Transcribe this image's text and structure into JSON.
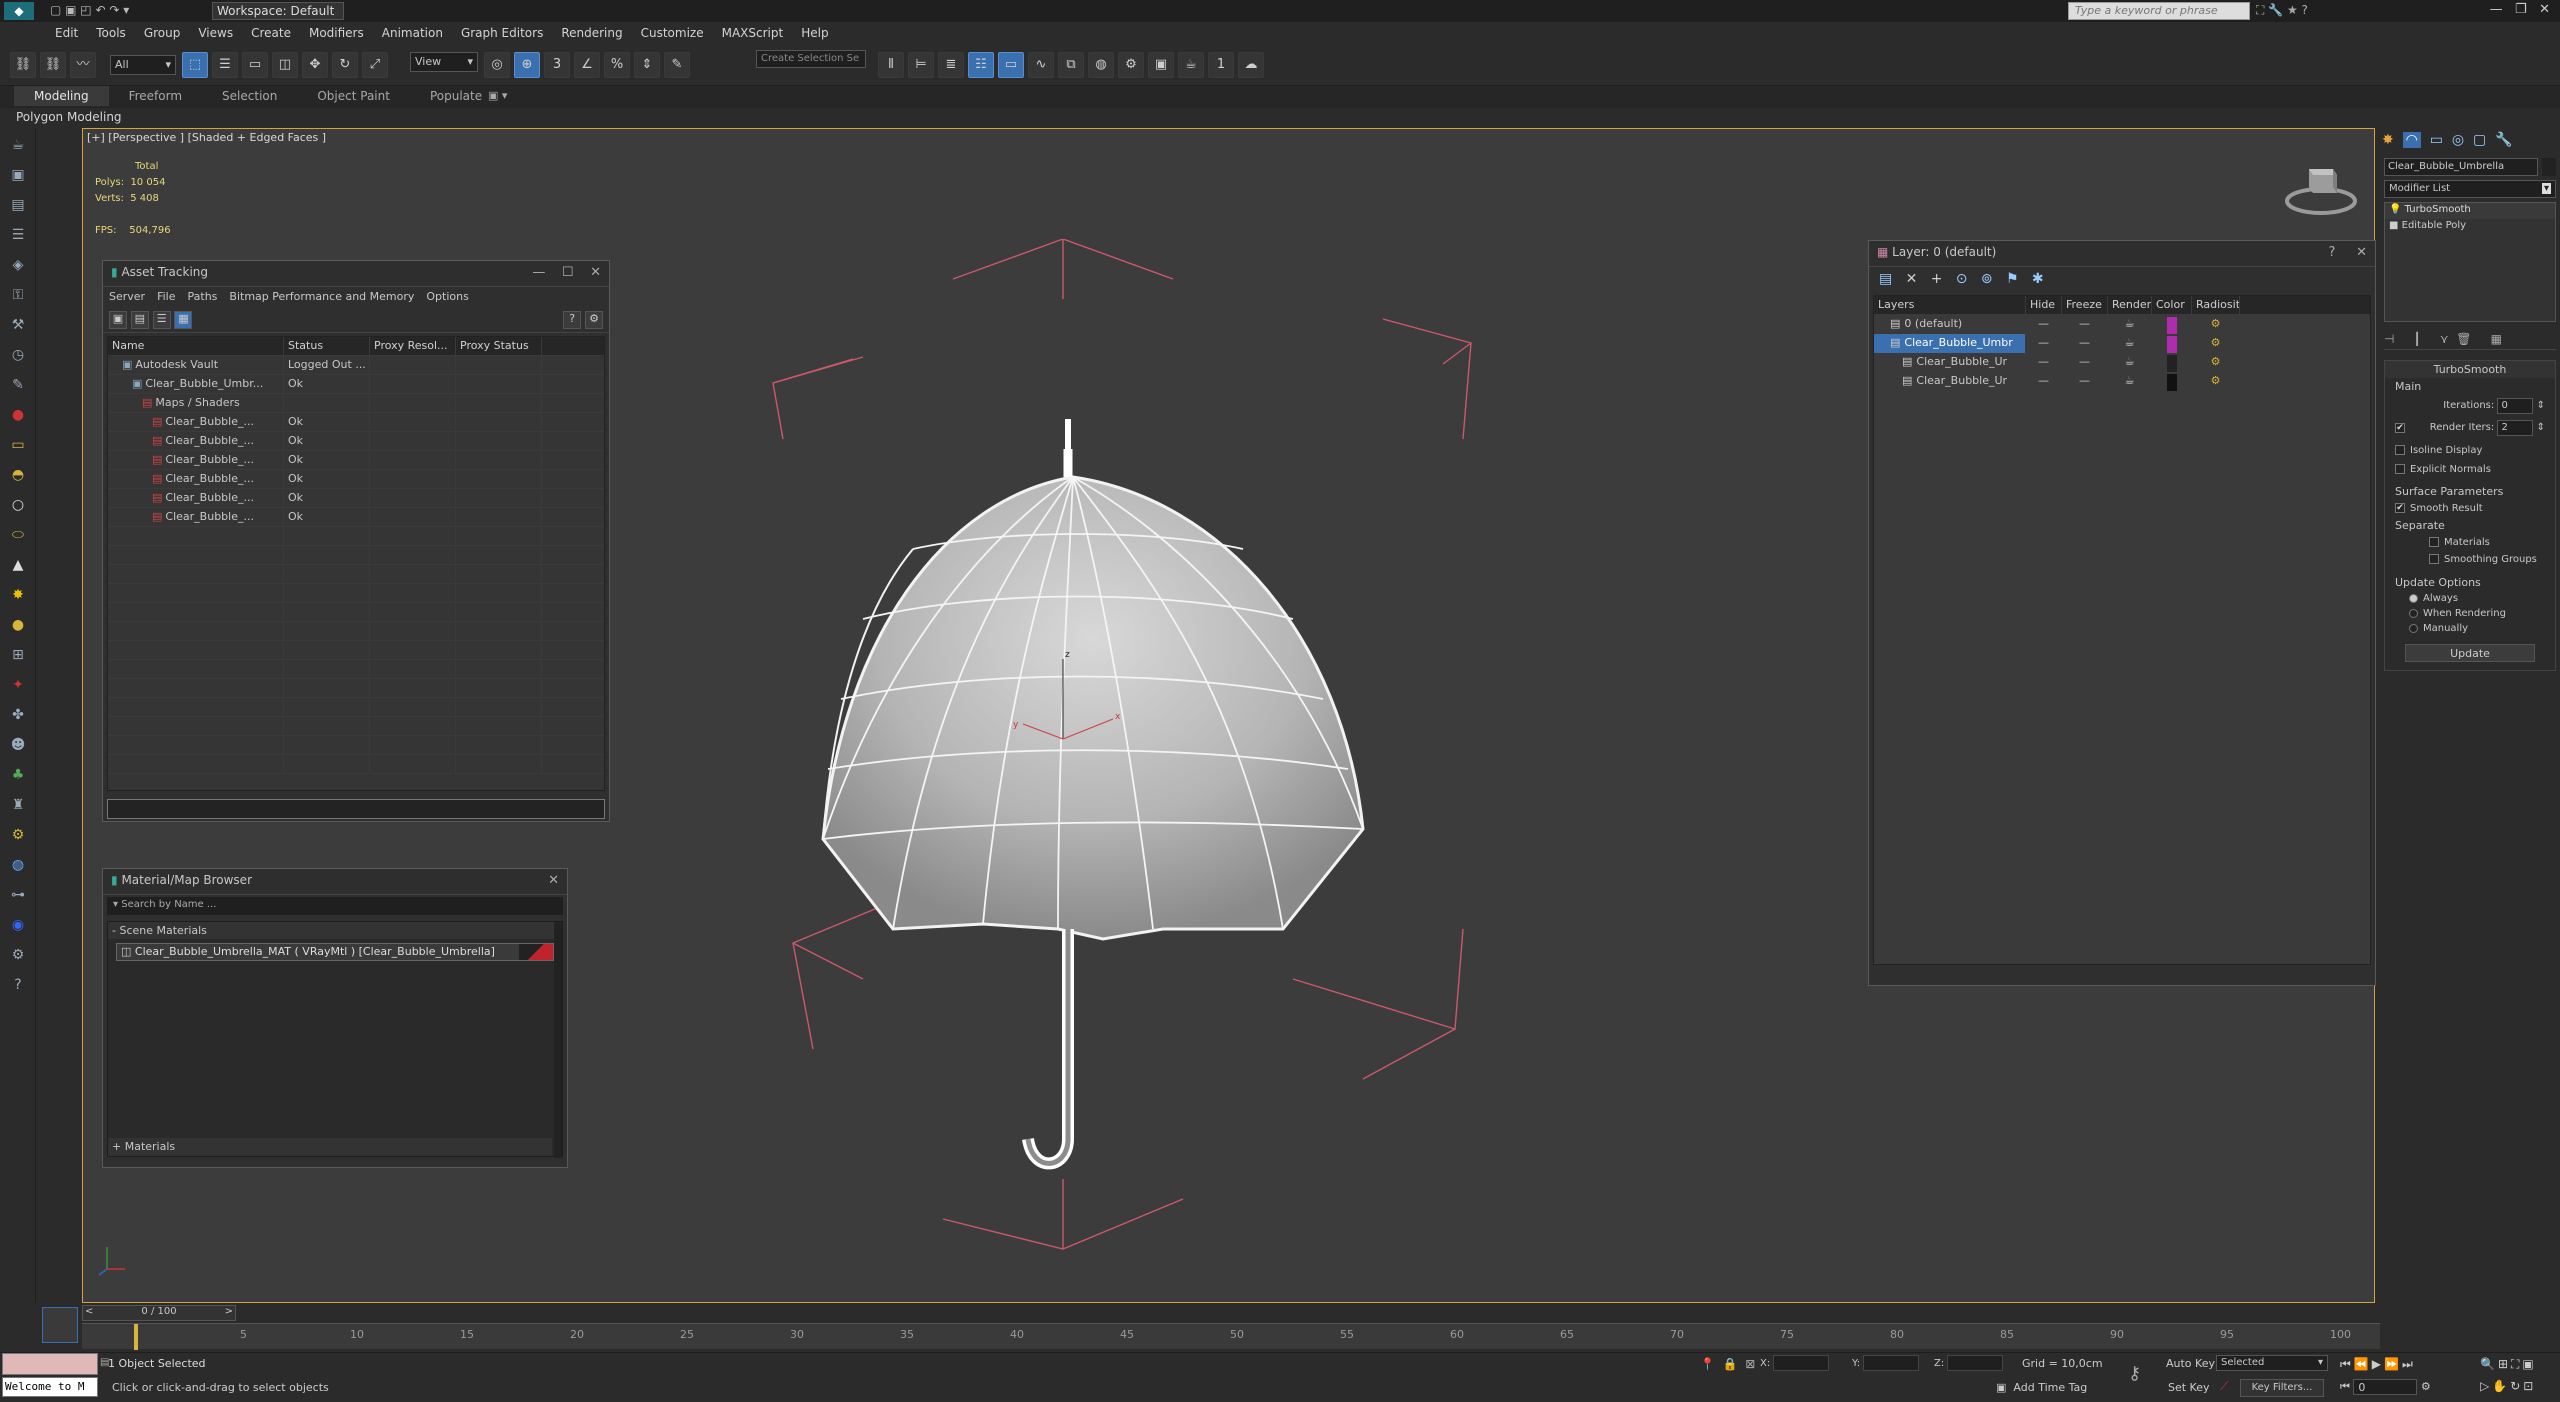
{
  "titlebar": {
    "workspace_label": "Workspace: Default",
    "search_placeholder": "Type a keyword or phrase"
  },
  "menu": [
    "Edit",
    "Tools",
    "Group",
    "Views",
    "Create",
    "Modifiers",
    "Animation",
    "Graph Editors",
    "Rendering",
    "Customize",
    "MAXScript",
    "Help"
  ],
  "toolbar": {
    "filter_value": "All",
    "refcoord_value": "View",
    "selection_set_placeholder": "Create Selection Se"
  },
  "ribbon": {
    "tabs": [
      "Modeling",
      "Freeform",
      "Selection",
      "Object Paint",
      "Populate"
    ],
    "subtab": "Polygon Modeling"
  },
  "viewport": {
    "label": "[+] [Perspective ] [Shaded + Edged Faces ]",
    "stats": {
      "total_label": "Total",
      "polys_label": "Polys:",
      "polys_value": "10 054",
      "verts_label": "Verts:",
      "verts_value": "5 408",
      "fps_label": "FPS:",
      "fps_value": "504,796"
    },
    "axis_labels": {
      "z": "z",
      "x": "x",
      "y": "y"
    }
  },
  "asset_tracking": {
    "title": "Asset Tracking",
    "menu": [
      "Server",
      "File",
      "Paths",
      "Bitmap Performance and Memory",
      "Options"
    ],
    "columns": [
      "Name",
      "Status",
      "Proxy Resol...",
      "Proxy Status"
    ],
    "rows": [
      {
        "name": "Autodesk Vault",
        "status": "Logged Out ...",
        "indent": 1
      },
      {
        "name": "Clear_Bubble_Umbr...",
        "status": "Ok",
        "indent": 2
      },
      {
        "name": "Maps / Shaders",
        "status": "",
        "indent": 3
      },
      {
        "name": "Clear_Bubble_...",
        "status": "Ok",
        "indent": 4
      },
      {
        "name": "Clear_Bubble_...",
        "status": "Ok",
        "indent": 4
      },
      {
        "name": "Clear_Bubble_...",
        "status": "Ok",
        "indent": 4
      },
      {
        "name": "Clear_Bubble_...",
        "status": "Ok",
        "indent": 4
      },
      {
        "name": "Clear_Bubble_...",
        "status": "Ok",
        "indent": 4
      },
      {
        "name": "Clear_Bubble_...",
        "status": "Ok",
        "indent": 4
      }
    ]
  },
  "material_browser": {
    "title": "Material/Map Browser",
    "search_placeholder": "Search by Name ...",
    "section_scene": "- Scene Materials",
    "material_item": "Clear_Bubble_Umbrella_MAT ( VRayMtl ) [Clear_Bubble_Umbrella]",
    "section_materials": "+ Materials"
  },
  "layer_explorer": {
    "title": "Layer: 0 (default)",
    "columns": [
      "Layers",
      "Hide",
      "Freeze",
      "Render",
      "Color",
      "Radiosity"
    ],
    "rows": [
      {
        "name": "0 (default)",
        "color": "#b02cae",
        "selected": false,
        "indent": 1
      },
      {
        "name": "Clear_Bubble_Umbr",
        "color": "#b02cae",
        "selected": true,
        "indent": 1
      },
      {
        "name": "Clear_Bubble_Ur",
        "color": "#222222",
        "selected": false,
        "indent": 2
      },
      {
        "name": "Clear_Bubble_Ur",
        "color": "#111111",
        "selected": false,
        "indent": 2
      }
    ]
  },
  "command_panel": {
    "object_name": "Clear_Bubble_Umbrella",
    "modifier_list_label": "Modifier List",
    "stack": [
      "TurboSmooth",
      "Editable Poly"
    ],
    "rollout_title": "TurboSmooth",
    "main_label": "Main",
    "iterations_label": "Iterations:",
    "iterations_value": "0",
    "render_iters_label": "Render Iters:",
    "render_iters_value": "2",
    "isoline_label": "Isoline Display",
    "explicit_normals_label": "Explicit Normals",
    "surface_params_label": "Surface Parameters",
    "smooth_result_label": "Smooth Result",
    "separate_label": "Separate",
    "materials_label": "Materials",
    "smoothing_groups_label": "Smoothing Groups",
    "update_options_label": "Update Options",
    "always_label": "Always",
    "when_rendering_label": "When Rendering",
    "manually_label": "Manually",
    "update_button": "Update"
  },
  "timeline": {
    "frame_label": "0 / 100",
    "ticks": [
      "5",
      "10",
      "15",
      "20",
      "25",
      "30",
      "35",
      "40",
      "45",
      "50",
      "55",
      "60",
      "65",
      "70",
      "75",
      "80",
      "85",
      "90",
      "95",
      "100"
    ]
  },
  "statusbar": {
    "maxscript_text": "Welcome to M",
    "selection_text": "1 Object Selected",
    "prompt_text": "Click or click-and-drag to select objects",
    "x_label": "X:",
    "y_label": "Y:",
    "z_label": "Z:",
    "grid_text": "Grid = 10,0cm",
    "add_time_tag": "Add Time Tag",
    "auto_key": "Auto Key",
    "set_key": "Set Key",
    "selected_value": "Selected",
    "key_filters": "Key Filters...",
    "frame_value": "0"
  },
  "colors": {
    "accent": "#3a6fb0",
    "viewport_border": "#d7a33b",
    "bounds_red": "#c9596b"
  }
}
